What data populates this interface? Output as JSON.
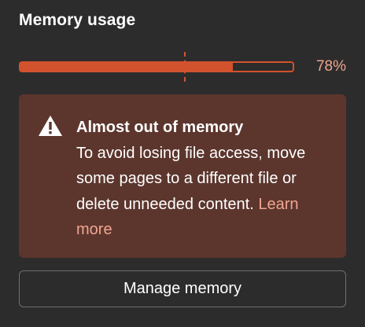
{
  "panel": {
    "title": "Memory usage"
  },
  "usage": {
    "percent_label": "78%",
    "fraction": 0.78,
    "warning_threshold_fraction": 0.6,
    "color": "#d2522e"
  },
  "alert": {
    "icon": "warning-icon",
    "heading": "Almost out of memory",
    "body": "To avoid losing file access, move some pages to a different file or delete unneeded content.",
    "link_label": "Learn more",
    "background": "#5c362d",
    "link_color": "#f0a58f"
  },
  "actions": {
    "manage_label": "Manage memory"
  }
}
